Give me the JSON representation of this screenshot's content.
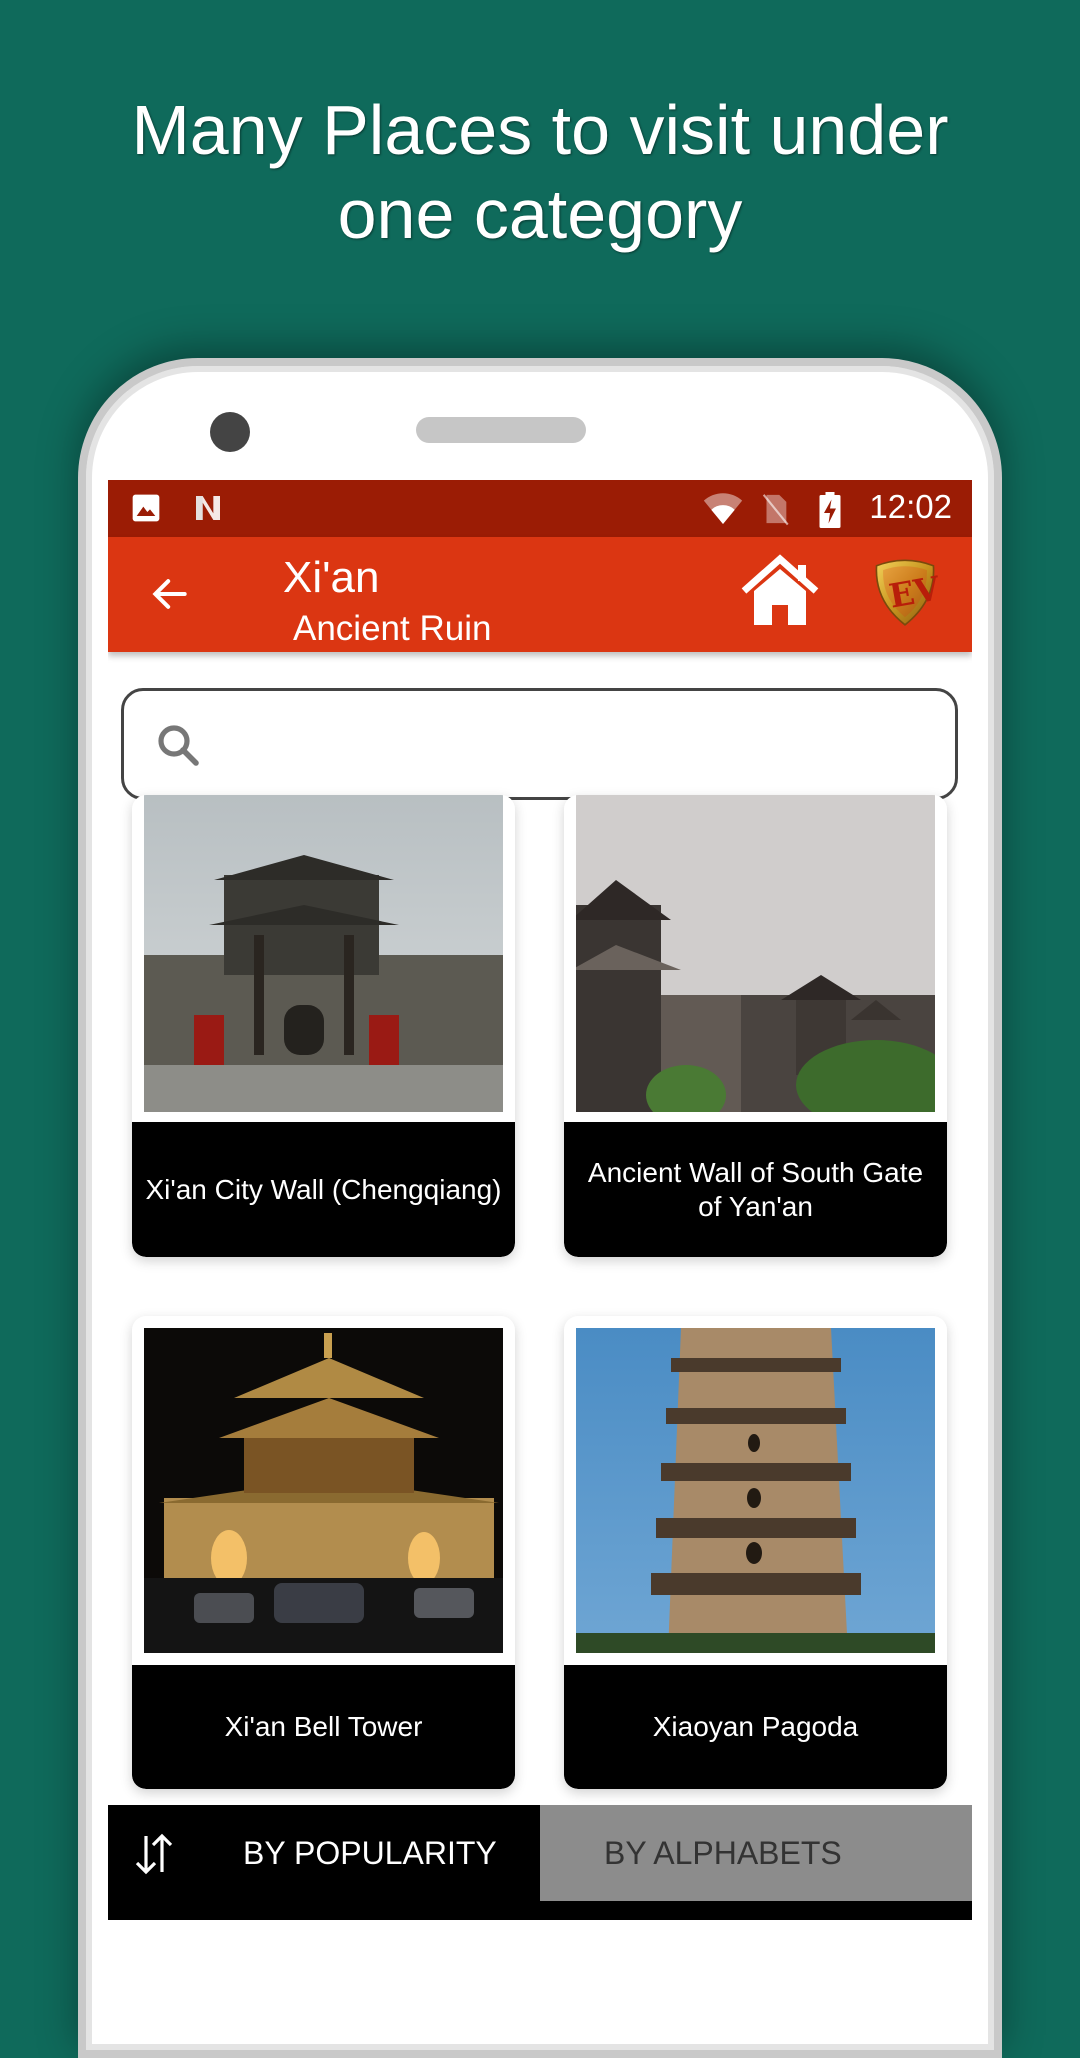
{
  "promo": {
    "headline_line1": "Many Places to visit under",
    "headline_line2": "one category",
    "background_color": "#0f6a5b"
  },
  "status_bar": {
    "left_icons": [
      "image-notification-icon",
      "n-app-notification-icon"
    ],
    "right_icons": [
      "wifi-icon",
      "no-sim-icon",
      "battery-charging-icon"
    ],
    "time": "12:02",
    "color": "#9b1c05"
  },
  "app_bar": {
    "title": "Xi'an",
    "subtitle": "Ancient Ruin",
    "back_icon": "arrow-left-icon",
    "home_icon": "home-icon",
    "logo": "EV",
    "color": "#db3612"
  },
  "search": {
    "placeholder": "",
    "value": "",
    "icon": "search-icon"
  },
  "places": [
    {
      "name": "Xi'an City Wall (Chengqiang)",
      "image": "city-wall-gate-photo"
    },
    {
      "name": "Ancient Wall of South Gate of Yan'an",
      "image": "south-gate-wall-photo"
    },
    {
      "name": "Xi'an Bell Tower",
      "image": "bell-tower-night-photo"
    },
    {
      "name": "Xiaoyan Pagoda",
      "image": "pagoda-photo"
    }
  ],
  "sort_bar": {
    "icon": "sort-arrows-icon",
    "tabs": [
      {
        "label": "BY POPULARITY",
        "selected": true
      },
      {
        "label": "BY ALPHABETS",
        "selected": false
      }
    ]
  }
}
